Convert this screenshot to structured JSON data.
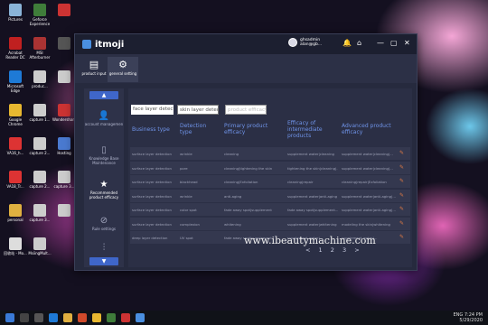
{
  "desktop": {
    "icons": [
      {
        "label": "Pictures",
        "color": "#8ab4d8"
      },
      {
        "label": "Geforce Experience",
        "color": "#3f7d3a"
      },
      {
        "label": "",
        "color": "#c33"
      },
      {
        "label": "Acrobat Reader DC",
        "color": "#c02020"
      },
      {
        "label": "MSI Afterburner",
        "color": "#a33"
      },
      {
        "label": "",
        "color": "#555"
      },
      {
        "label": "Microsoft Edge",
        "color": "#1e7ad6"
      },
      {
        "label": "produc...",
        "color": "#ccc"
      },
      {
        "label": "",
        "color": "#ccc"
      },
      {
        "label": "Google Chrome",
        "color": "#e8b830"
      },
      {
        "label": "capture 1...",
        "color": "#ccc"
      },
      {
        "label": "Wondershare...",
        "color": "#c33"
      },
      {
        "label": "VA16_h...",
        "color": "#d33"
      },
      {
        "label": "capture 2...",
        "color": "#ccc"
      },
      {
        "label": "Hosting",
        "color": "#4a7ad0"
      },
      {
        "label": "VA18_Tr...",
        "color": "#d33"
      },
      {
        "label": "capture 2...",
        "color": "#ccc"
      },
      {
        "label": "capture 3...",
        "color": "#ccc"
      },
      {
        "label": "personal",
        "color": "#e0b040"
      },
      {
        "label": "capture 3...",
        "color": "#ccc"
      },
      {
        "label": "",
        "color": "#ccc"
      },
      {
        "label": "回收站 - Mo...",
        "color": "#ddd"
      },
      {
        "label": "MsiingMult...",
        "color": "#ccc"
      }
    ]
  },
  "app": {
    "title": "itmoji",
    "user_name": "ghsadmin",
    "user_email": "alan@gb...",
    "window_controls": [
      "—",
      "▢",
      "✕"
    ]
  },
  "toolbar": {
    "tools": [
      {
        "label": "product input",
        "icon": "doc-icon"
      },
      {
        "label": "general setting",
        "icon": "gear-icon"
      }
    ]
  },
  "sidebar": {
    "items": [
      {
        "label": "account managemen",
        "icon": "user-icon"
      },
      {
        "label": "Knowledge Base Maintenance",
        "icon": "book-icon"
      },
      {
        "label": "Recommended product efficacy",
        "icon": "star-icon"
      },
      {
        "label": "Rule settings",
        "icon": "ban-icon"
      },
      {
        "label": "",
        "icon": "sliders-icon"
      }
    ]
  },
  "filters": {
    "business_type": "face layer detect",
    "detection_type": "skin layer detecti",
    "primary_efficacy_placeholder": "product efficacy"
  },
  "table": {
    "headers": [
      "Business type",
      "Detection type",
      "Primary product efficacy",
      "Efficacy of intermediate products",
      "Advanced product efficacy"
    ],
    "rows": [
      [
        "surface layer detection",
        "wrinkle",
        "cleaning",
        "supplement water|cleaning",
        "supplement water|cleaning|..."
      ],
      [
        "surface layer detection",
        "pore",
        "cleaning|tightening the skin",
        "tightening the skin|cleaning|...",
        "supplement water|cleaning|..."
      ],
      [
        "surface layer detection",
        "blackhead",
        "cleaning|Exfoliation",
        "cleaning|repair",
        "cleaning|repair|Exfoliation"
      ],
      [
        "surface layer detection",
        "wrinkle",
        "anti-aging",
        "supplement water|anti-aging",
        "supplement water|anti-aging|..."
      ],
      [
        "surface layer detection",
        "color spot",
        "fade away spot|supplement",
        "fade away spot|supplement...",
        "supplement water|anti-aging|..."
      ],
      [
        "surface layer detection",
        "complexion",
        "whitening",
        "supplement water|whitening",
        "modeling the skin|whitening"
      ],
      [
        "deep layer detection",
        "UV spot",
        "fade away spot|supplement",
        "supplement water|...",
        "supplement water|..."
      ]
    ]
  },
  "pagination": {
    "prev": "<",
    "pages": [
      "1",
      "2",
      "3"
    ],
    "next": ">"
  },
  "watermark": "www.ibeautymachine.com",
  "taskbar": {
    "time": "7:24 PM",
    "date": "5/29/2020",
    "lang": "ENG"
  }
}
